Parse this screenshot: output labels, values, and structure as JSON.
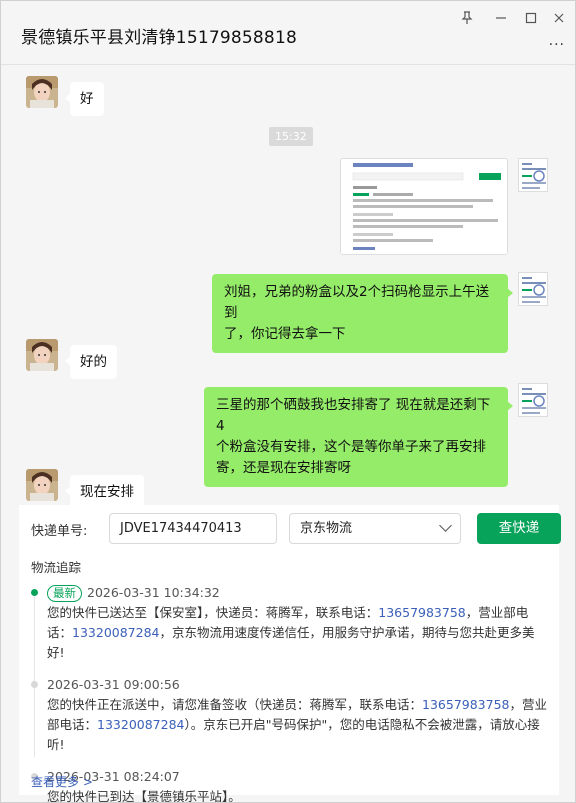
{
  "window": {
    "title": "景德镇乐平县刘清铮15179858818",
    "controls": {
      "pin": "⊥",
      "minimize": "—",
      "maximize": "☐",
      "close": "✕"
    },
    "more": "···"
  },
  "chat": {
    "messages": [
      {
        "from": "other",
        "text": "好"
      },
      {
        "type": "time",
        "text": "15:32"
      },
      {
        "from": "me",
        "type": "image"
      },
      {
        "from": "me",
        "text_line1": "刘姐，兄弟的粉盒以及2个扫码枪显示上午送到",
        "text_line2": "了，你记得去拿一下"
      },
      {
        "from": "other",
        "text": "好的"
      },
      {
        "from": "me",
        "text_line1": "三星的那个硒鼓我也安排寄了  现在就是还剩下4",
        "text_line2": "个粉盒没有安排，这个是等你单子来了再安排",
        "text_line3": "寄，还是现在安排寄呀"
      },
      {
        "from": "other",
        "text": "现在安排"
      }
    ]
  },
  "express": {
    "tracking_label": "快递单号:",
    "tracking_number": "JDVE17434470413",
    "carrier": "京东物流",
    "query_button": "查快递",
    "track_title": "物流追踪",
    "events": [
      {
        "tag": "最新",
        "time": "2026-03-31 10:34:32",
        "p1": "您的快件已送达至【保安室】，快递员：蒋腾军，联系电话：",
        "tel1": "13657983758",
        "p2": "，营业部电话：",
        "tel2": "13320087284",
        "p3": "，京东物流用速度传递信任，用服务守护承诺，期待与您共赴更多美好!"
      },
      {
        "time": "2026-03-31 09:00:56",
        "p1": "您的快件正在派送中，请您准备签收（快递员：蒋腾军，联系电话：",
        "tel1": "13657983758",
        "p2": "，营业部电话：",
        "tel2": "13320087284",
        "p3": "）。京东已开启\"号码保护\"，您的电话隐私不会被泄露，请放心接听!"
      },
      {
        "time": "2026-03-31 08:24:07",
        "p1": "您的快件已到达【景德镇乐平站】。"
      }
    ],
    "more_link": "查看更多 >"
  },
  "colors": {
    "accent": "#07a35a",
    "bubble_me": "#95ec69",
    "link": "#3b5fb8"
  }
}
